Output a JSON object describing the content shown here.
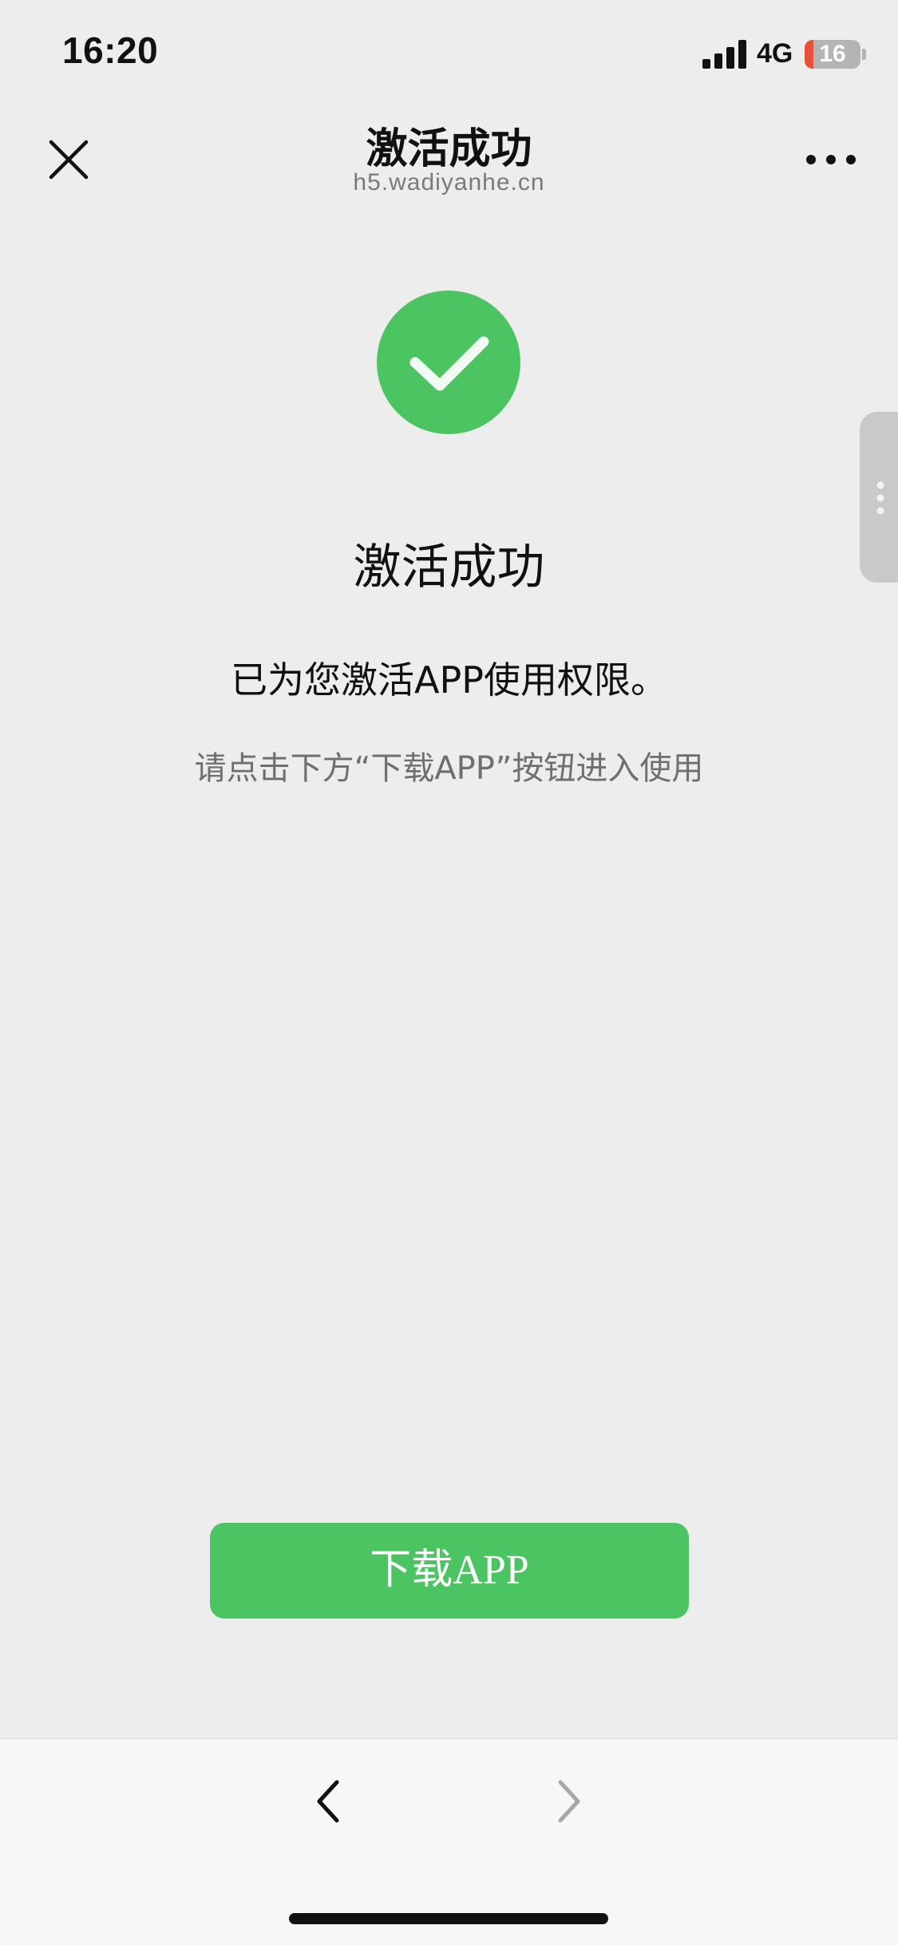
{
  "status_bar": {
    "time": "16:20",
    "network": "4G",
    "battery_level": "16",
    "battery_fraction": 0.16,
    "signal_icon": "signal-bars-icon"
  },
  "header": {
    "title": "激活成功",
    "url": "h5.wadiyanhe.cn",
    "close_icon": "close-icon",
    "more_icon": "more-icon"
  },
  "main": {
    "success_icon": "check-circle-icon",
    "title": "激活成功",
    "message": "已为您激活APP使用权限。",
    "hint": "请点击下方“下载APP”按钮进入使用",
    "download_button": "下载APP"
  },
  "toolbar": {
    "back_icon": "chevron-left-icon",
    "forward_icon": "chevron-right-icon"
  },
  "colors": {
    "accent_green": "#4cc462",
    "background": "#ededed",
    "battery_low": "#e9503a"
  }
}
